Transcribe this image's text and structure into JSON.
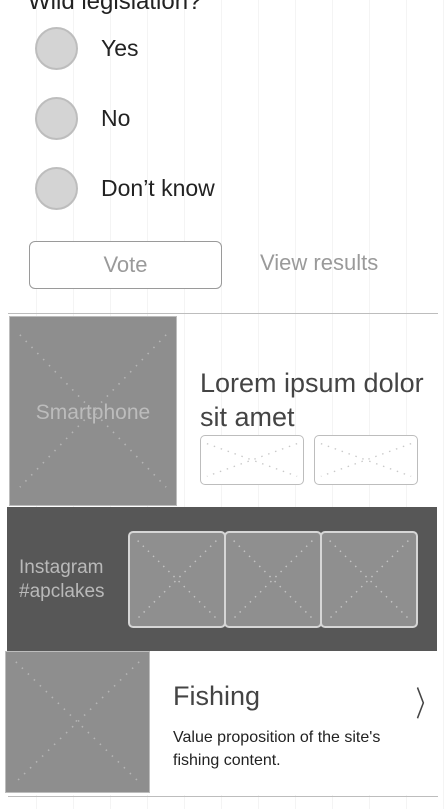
{
  "poll": {
    "question": "Wild legislation?",
    "options": [
      "Yes",
      "No",
      "Don’t know"
    ],
    "vote_label": "Vote",
    "view_results_label": "View results"
  },
  "promo": {
    "image_label": "Smartphone",
    "title": "Lorem ipsum dolor sit amet"
  },
  "instagram": {
    "label_line1": "Instagram",
    "label_line2": "#apclakes"
  },
  "fishing": {
    "title": "Fishing",
    "description": "Value proposition of the site's fishing content."
  },
  "colors": {
    "placeholder_gray": "#8e8e8e",
    "dark_band": "#575757",
    "radio_fill": "#d4d4d4",
    "muted_text": "#9a9a9a"
  },
  "icons": {
    "chevron": "chevron-right-icon",
    "image_placeholder": "image-placeholder-icon"
  }
}
